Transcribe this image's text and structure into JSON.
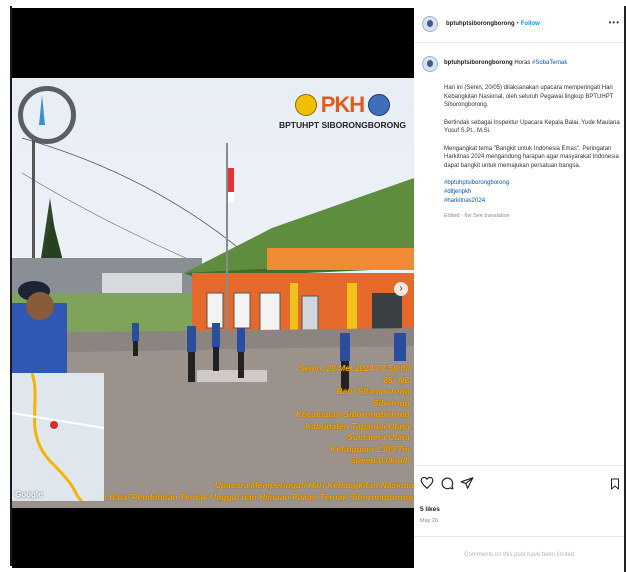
{
  "post": {
    "username": "bptuhptsiborongborong",
    "separator": "•",
    "follow_label": "Follow",
    "more_label": "•••",
    "caption_user": "bptuhptsiborongborong",
    "caption_head_text": "Horas",
    "caption_head_tag": "#SobaTernak",
    "paragraphs": [
      "Hari ini (Senin, 20/05) dilaksanakan upacara memperingati Hari\nKebangkitan Nasional, oleh seluruh Pegawai lingkup BPTUHPT\nSiborongborong.",
      "Bertindak sebagai Inspektur Upacara Kepala Balai, Yude Maulana\nYusuf S.Pt., M.Si.",
      "Mengangkat tema \"Bangkit untuk Indonesia Emas\". Peringatan\nHarkitnas 2024 mengandung harapan agar masyarakat Indonesia\ndapat bangkit untuk memajukan persatuan bangsa."
    ],
    "hashtags": [
      "#bptuhptsiborongborong",
      "#ditjenpkh",
      "#harkitnas2024"
    ],
    "edited": "Edited · 6w",
    "see_translation": "See translation",
    "likes": "5 likes",
    "date": "May 20",
    "comments_limited": "Comments on this post have been limited."
  },
  "media": {
    "brand_pkh": "PKH",
    "brand_name": "BPTUHPT SIBORONGBORONG",
    "stamp_lines": [
      "Senin, 20 Mei 2024 07:58:08",
      "25° NE",
      "Batu Sitampurung",
      "Siborong",
      "Kecamatan Siborongborong",
      "Kabupaten Tapanuli Utara",
      "Sumatera Utara",
      "Ketinggian 1309,7m",
      "Speed:0.0km/h"
    ],
    "stamp_footer": [
      "Upacara Memperingati Hari Kebangkitan Nasional",
      "pada Balai Pembibitan Ternak Unggul dan Hijauan Pakan Ternak Siborongborong"
    ],
    "map_label": "Google",
    "compass_label": "compass"
  },
  "colors": {
    "accent": "#0095f6",
    "hashtag": "#0a55a8",
    "stamp": "#f7a400"
  },
  "icons": [
    "heart-icon",
    "comment-icon",
    "share-icon",
    "bookmark-icon",
    "more-options-icon",
    "chevron-right-icon"
  ]
}
